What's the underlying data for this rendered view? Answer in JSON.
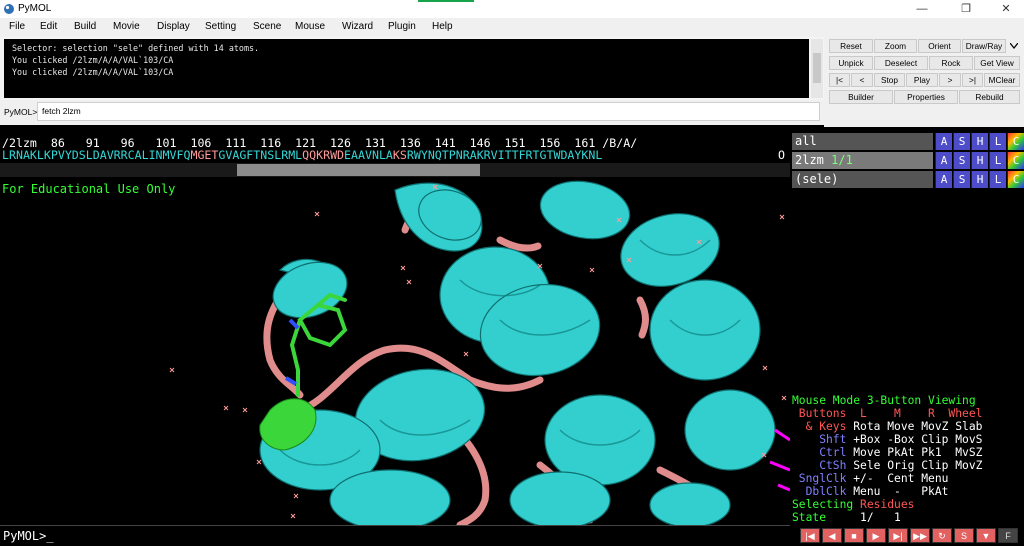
{
  "window": {
    "title": "PyMOL",
    "minimize": "—",
    "maximize": "❐",
    "close": "✕"
  },
  "menu": [
    "File",
    "Edit",
    "Build",
    "Movie",
    "Display",
    "Setting",
    "Scene",
    "Mouse",
    "Wizard",
    "Plugin",
    "Help"
  ],
  "log": [
    "Selector: selection \"sele\" defined with 14 atoms.",
    "You clicked /2lzm/A/A/VAL`103/CA",
    "You clicked /2lzm/A/A/VAL`103/CA"
  ],
  "command": {
    "prompt": "PyMOL>",
    "value": "fetch 2lzm"
  },
  "buttons": {
    "reset": "Reset",
    "zoom": "Zoom",
    "orient": "Orient",
    "drawray": "Draw/Ray",
    "unpick": "Unpick",
    "deselect": "Deselect",
    "rock": "Rock",
    "getview": "Get View",
    "first": "|<",
    "prev": "<",
    "stop": "Stop",
    "play": "Play",
    "next": ">",
    "last": ">|",
    "mclear": "MClear",
    "builder": "Builder",
    "properties": "Properties",
    "rebuild": "Rebuild"
  },
  "sequence": {
    "numbers": "/2lzm  86   91   96   101  106  111  116  121  126  131  136  141  146  151  156  161 /B/A/",
    "residues": "LRNAKLKPVYDSLDAVRRCALINMVFQMGETGVAGFTNSLRMLQQKRWDEAAVNLAKSRWYNQTPNRAKRVITTFRTGTWDAYKNL",
    "end_char": "O"
  },
  "watermark": "For Educational Use Only",
  "objects": [
    {
      "name": "all",
      "count": "",
      "actions": [
        "A",
        "S",
        "H",
        "L",
        "C"
      ]
    },
    {
      "name": "2lzm",
      "count": "1/1",
      "actions": [
        "A",
        "S",
        "H",
        "L",
        "C"
      ]
    },
    {
      "name": "(sele)",
      "count": "",
      "actions": [
        "A",
        "S",
        "H",
        "L",
        "C"
      ]
    }
  ],
  "mouse_mode": {
    "title": "Mouse Mode 3-Button Viewing",
    "header": " Buttons  L    M    R  Wheel",
    "rows": [
      {
        "label": "  & Keys",
        "vals": " Rota Move MovZ Slab"
      },
      {
        "label": "    Shft",
        "vals": " +Box -Box Clip MovS"
      },
      {
        "label": "    Ctrl",
        "vals": " Move PkAt Pk1  MvSZ"
      },
      {
        "label": "    CtSh",
        "vals": " Sele Orig Clip MovZ"
      },
      {
        "label": " SnglClk",
        "vals": " +/-  Cent Menu"
      },
      {
        "label": "  DblClk",
        "vals": " Menu  -   PkAt"
      }
    ],
    "selecting_label": "Selecting",
    "selecting_value": "Residues",
    "state_label": "State",
    "state_value": "1/   1"
  },
  "bottom_prompt": "PyMOL>_",
  "movie_controls": [
    "|◀",
    "◀",
    "■",
    "▶",
    "▶|",
    "▶▶",
    "↻",
    "S",
    "▼",
    "F"
  ]
}
